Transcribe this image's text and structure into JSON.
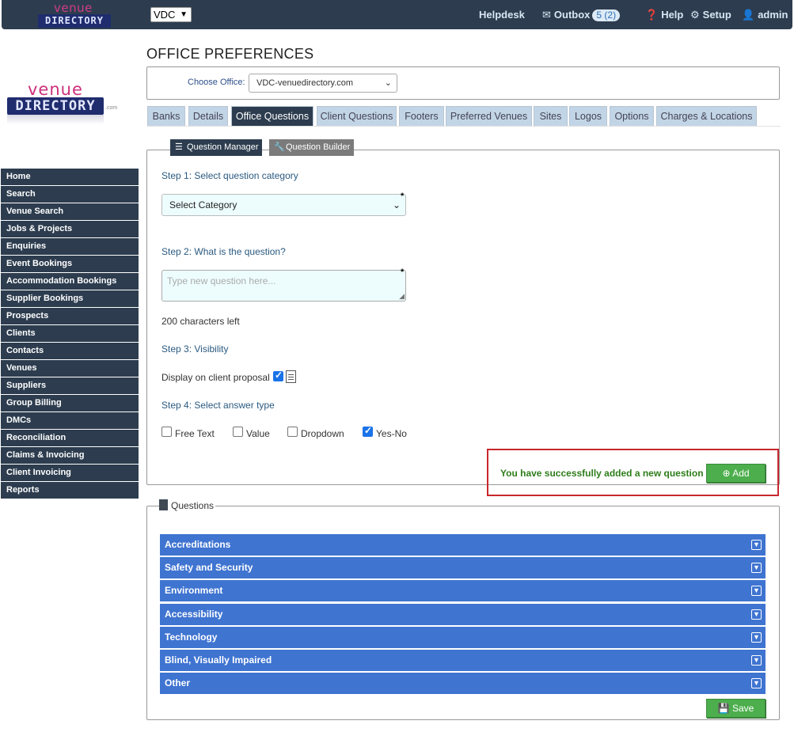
{
  "colors": {
    "topbar": "#2d3d4f",
    "accordion": "#3f74d1",
    "success": "#2e7d1a",
    "button_green": "#4cae4c",
    "highlight_border": "#c9272e"
  },
  "topbar": {
    "logo_top": "venue",
    "logo_bottom": "DIRECTORY",
    "office_selector": "VDC",
    "helpdesk": "Helpdesk",
    "outbox": "Outbox",
    "outbox_badge": "5 (2)",
    "help": "Help",
    "setup": "Setup",
    "user": "admin"
  },
  "side_logo": {
    "top": "venue",
    "bottom": "DIRECTORY",
    "suffix": ".com"
  },
  "sidebar": {
    "items": [
      "Home",
      "Search",
      "Venue Search",
      "Jobs & Projects",
      "Enquiries",
      "Event Bookings",
      "Accommodation Bookings",
      "Supplier Bookings",
      "Prospects",
      "Clients",
      "Contacts",
      "Venues",
      "Suppliers",
      "Group Billing",
      "DMCs",
      "Reconciliation",
      "Claims & Invoicing",
      "Client Invoicing",
      "Reports"
    ]
  },
  "page": {
    "title": "OFFICE PREFERENCES",
    "choose_office_label": "Choose Office:",
    "choose_office_value": "VDC-venuedirectory.com"
  },
  "tabs": [
    {
      "label": "Banks",
      "active": false
    },
    {
      "label": "Details",
      "active": false
    },
    {
      "label": "Office Questions",
      "active": true
    },
    {
      "label": "Client Questions",
      "active": false
    },
    {
      "label": "Footers",
      "active": false
    },
    {
      "label": "Preferred Venues",
      "active": false
    },
    {
      "label": "Sites",
      "active": false
    },
    {
      "label": "Logos",
      "active": false
    },
    {
      "label": "Options",
      "active": false
    },
    {
      "label": "Charges & Locations",
      "active": false
    }
  ],
  "subtabs": {
    "manager": "Question Manager",
    "builder": "Question Builder"
  },
  "form": {
    "step1": "Step 1: Select question category",
    "category_value": "Select Category",
    "step2": "Step 2: What is the question?",
    "question_placeholder": "Type new question here...",
    "chars_left": "200 characters left",
    "step3": "Step 3: Visibility",
    "display_label": "Display on client proposal",
    "display_checked": true,
    "step4": "Step 4: Select answer type",
    "answer_types": [
      {
        "label": "Free Text",
        "checked": false
      },
      {
        "label": "Value",
        "checked": false
      },
      {
        "label": "Dropdown",
        "checked": false
      },
      {
        "label": "Yes-No",
        "checked": true
      }
    ],
    "required_mark": "*",
    "success_message": "You have successfully added a new question",
    "add_label": "Add"
  },
  "questions": {
    "legend": "Questions",
    "categories": [
      "Accreditations",
      "Safety and Security",
      "Environment",
      "Accessibility",
      "Technology",
      "Blind, Visually Impaired",
      "Other"
    ],
    "save_label": "Save"
  }
}
